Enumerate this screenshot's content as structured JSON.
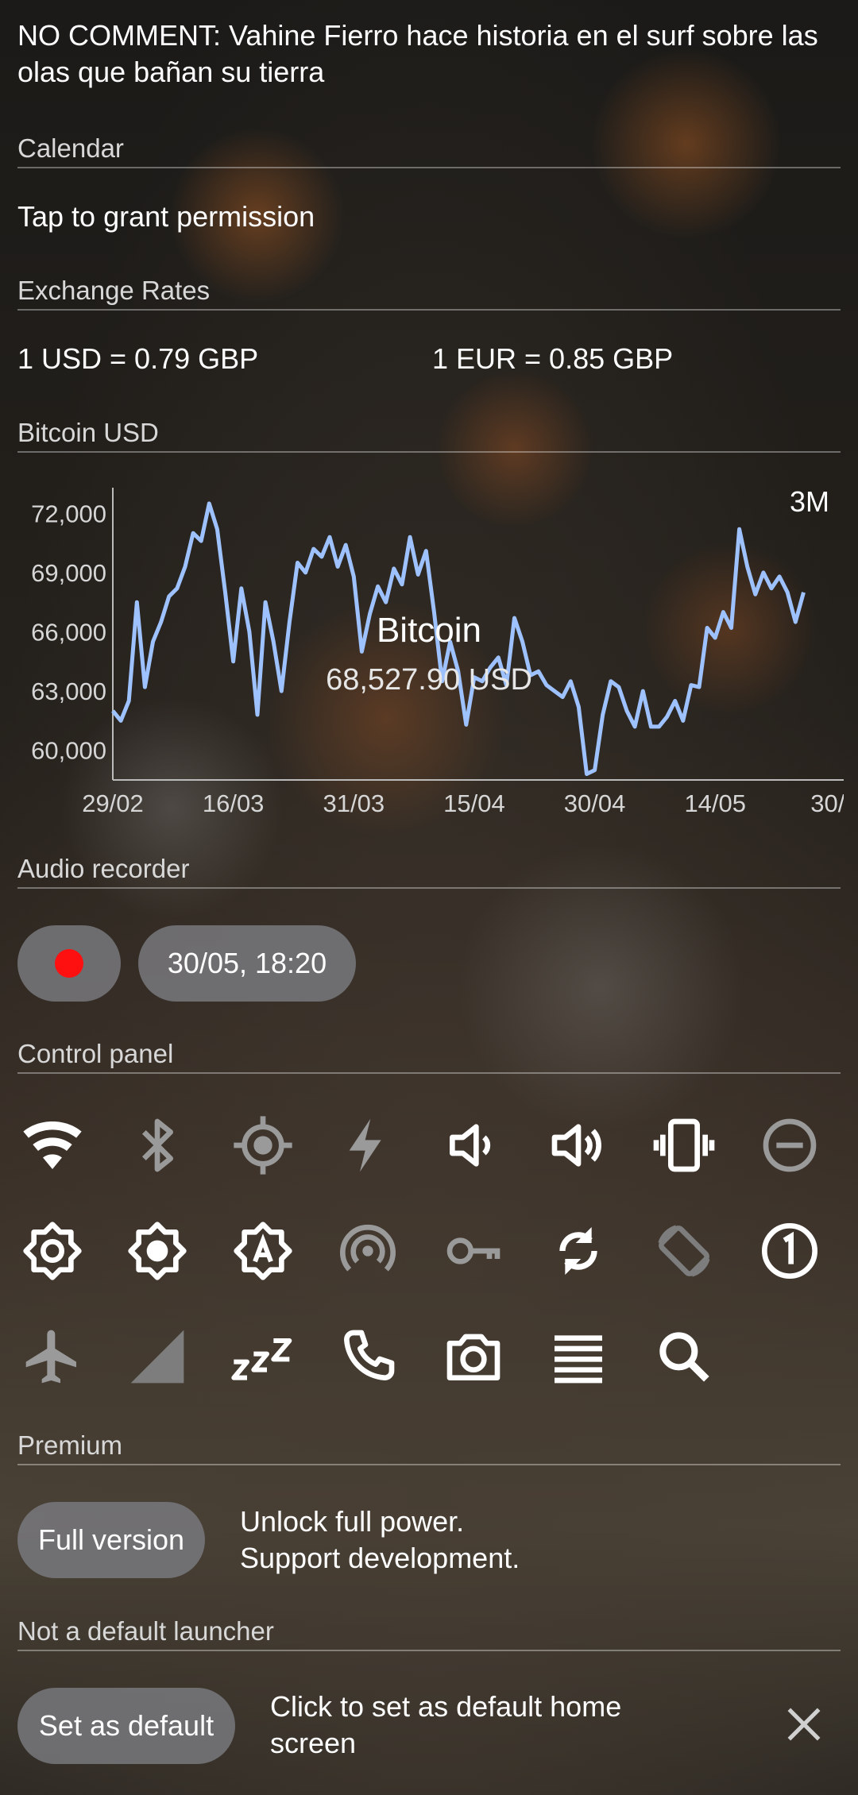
{
  "news": {
    "headline": "NO COMMENT: Vahine Fierro hace historia en el surf sobre las olas que bañan su tierra"
  },
  "calendar": {
    "title": "Calendar",
    "message": "Tap to grant permission"
  },
  "exchange": {
    "title": "Exchange Rates",
    "rate1": "1 USD = 0.79 GBP",
    "rate2": "1 EUR = 0.85 GBP"
  },
  "bitcoin": {
    "title": "Bitcoin USD",
    "period": "3M",
    "name": "Bitcoin",
    "price": "68,527.90 USD"
  },
  "chart_data": {
    "type": "line",
    "title": "",
    "xlabel": "",
    "ylabel": "",
    "ylim": [
      58500,
      73300
    ],
    "xlim": [
      0,
      91
    ],
    "y_ticks": [
      "72,000",
      "69,000",
      "66,000",
      "63,000",
      "60,000"
    ],
    "y_tick_values": [
      72000,
      69000,
      66000,
      63000,
      60000
    ],
    "x_ticks": [
      "29/02",
      "16/03",
      "31/03",
      "15/04",
      "30/04",
      "14/05",
      "30/"
    ],
    "x_tick_values": [
      0,
      15,
      30,
      45,
      60,
      75,
      89
    ],
    "line_color": "#9ec2ff",
    "series": [
      {
        "values": [
          [
            0,
            62000
          ],
          [
            1,
            61500
          ],
          [
            2,
            62500
          ],
          [
            3,
            67500
          ],
          [
            4,
            63200
          ],
          [
            5,
            65500
          ],
          [
            6,
            66500
          ],
          [
            7,
            67800
          ],
          [
            8,
            68200
          ],
          [
            9,
            69300
          ],
          [
            10,
            71000
          ],
          [
            11,
            70600
          ],
          [
            12,
            72500
          ],
          [
            13,
            71200
          ],
          [
            14,
            68000
          ],
          [
            15,
            64500
          ],
          [
            16,
            68200
          ],
          [
            17,
            66000
          ],
          [
            18,
            61800
          ],
          [
            19,
            67500
          ],
          [
            20,
            65500
          ],
          [
            21,
            63000
          ],
          [
            22,
            66500
          ],
          [
            23,
            69500
          ],
          [
            24,
            69000
          ],
          [
            25,
            70200
          ],
          [
            26,
            69800
          ],
          [
            27,
            70800
          ],
          [
            28,
            69300
          ],
          [
            29,
            70400
          ],
          [
            30,
            68800
          ],
          [
            31,
            65000
          ],
          [
            32,
            66900
          ],
          [
            33,
            68300
          ],
          [
            34,
            67500
          ],
          [
            35,
            69200
          ],
          [
            36,
            68400
          ],
          [
            37,
            70800
          ],
          [
            38,
            68900
          ],
          [
            39,
            70100
          ],
          [
            40,
            67000
          ],
          [
            41,
            63500
          ],
          [
            42,
            65500
          ],
          [
            43,
            64000
          ],
          [
            44,
            61300
          ],
          [
            45,
            63700
          ],
          [
            46,
            63500
          ],
          [
            47,
            64200
          ],
          [
            48,
            64700
          ],
          [
            49,
            63300
          ],
          [
            50,
            66700
          ],
          [
            51,
            65500
          ],
          [
            52,
            63800
          ],
          [
            53,
            64000
          ],
          [
            54,
            63300
          ],
          [
            55,
            63000
          ],
          [
            56,
            62700
          ],
          [
            57,
            63500
          ],
          [
            58,
            62200
          ],
          [
            59,
            58800
          ],
          [
            60,
            59000
          ],
          [
            61,
            61800
          ],
          [
            62,
            63500
          ],
          [
            63,
            63200
          ],
          [
            64,
            62000
          ],
          [
            65,
            61200
          ],
          [
            66,
            63000
          ],
          [
            67,
            61200
          ],
          [
            68,
            61200
          ],
          [
            69,
            61700
          ],
          [
            70,
            62500
          ],
          [
            71,
            61500
          ],
          [
            72,
            63300
          ],
          [
            73,
            63200
          ],
          [
            74,
            66200
          ],
          [
            75,
            65700
          ],
          [
            76,
            67000
          ],
          [
            77,
            66200
          ],
          [
            78,
            71200
          ],
          [
            79,
            69300
          ],
          [
            80,
            67900
          ],
          [
            81,
            69000
          ],
          [
            82,
            68200
          ],
          [
            83,
            68800
          ],
          [
            84,
            68000
          ],
          [
            85,
            66500
          ],
          [
            86,
            68000
          ]
        ]
      }
    ]
  },
  "audio": {
    "title": "Audio recorder",
    "timestamp": "30/05, 18:20"
  },
  "control": {
    "title": "Control panel"
  },
  "premium": {
    "title": "Premium",
    "button": "Full version",
    "line1": "Unlock full power.",
    "line2": "Support development."
  },
  "launcher": {
    "title": "Not a default launcher",
    "button": "Set as default",
    "message": "Click to set as default home screen"
  }
}
